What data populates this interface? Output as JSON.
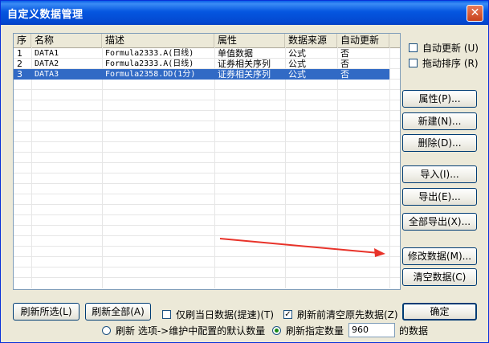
{
  "window": {
    "title": "自定义数据管理",
    "close_glyph": "✕"
  },
  "table": {
    "columns": [
      "序",
      "名称",
      "描述",
      "属性",
      "数据来源",
      "自动更新"
    ],
    "rows": [
      [
        "1",
        "DATA1",
        "Formula2333.A(日线)",
        "单值数据",
        "公式",
        "否"
      ],
      [
        "2",
        "DATA2",
        "Formula2333.A(日线)",
        "证券相关序列",
        "公式",
        "否"
      ],
      [
        "3",
        "DATA3",
        "Formula2358.DD(1分)",
        "证券相关序列",
        "公式",
        "否"
      ]
    ],
    "selected_row": 2
  },
  "options": {
    "auto_update": "自动更新 (U)",
    "drag_sort": "拖动排序 (R)"
  },
  "side_buttons": {
    "properties": "属性(P)...",
    "new": "新建(N)...",
    "delete": "删除(D)...",
    "import": "导入(I)...",
    "export": "导出(E)...",
    "export_all": "全部导出(X)...",
    "modify": "修改数据(M)...",
    "clear": "清空数据(C)"
  },
  "bottom": {
    "refresh_selected": "刷新所选(L)",
    "refresh_all": "刷新全部(A)",
    "today_only": "仅刷当日数据(提速)(T)",
    "clear_before": "刷新前清空原先数据(Z)",
    "ok": "确定",
    "radio_default": "刷新 选项->维护中配置的默认数量",
    "radio_count": "刷新指定数量",
    "count_value": "960",
    "count_suffix": "的数据"
  },
  "colors": {
    "title_bar": "#0556e0",
    "selection": "#316ac5",
    "arrow": "#e8332a"
  }
}
